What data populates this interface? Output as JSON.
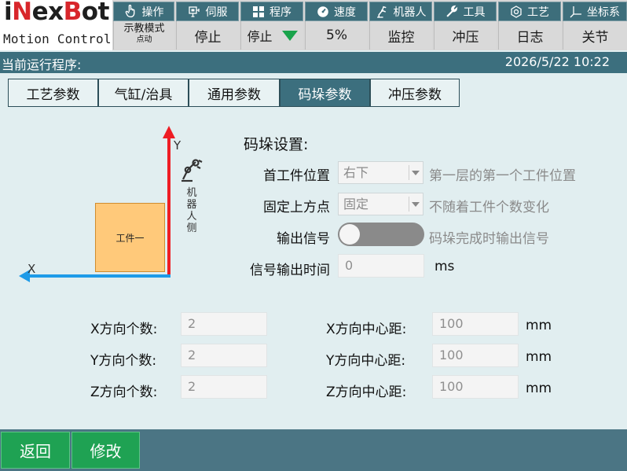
{
  "logo": {
    "brand_i": "i",
    "brand_n": "N",
    "brand_ex": "ex",
    "brand_b": "B",
    "brand_ot": "ot",
    "subtitle": "Motion Control"
  },
  "top_menu": [
    {
      "label": "操作",
      "icon": "hand-pointer-icon"
    },
    {
      "label": "伺服",
      "icon": "servo-icon"
    },
    {
      "label": "程序",
      "icon": "program-grid-icon"
    },
    {
      "label": "速度",
      "icon": "speed-gauge-icon"
    },
    {
      "label": "机器人",
      "icon": "robot-arm-icon"
    },
    {
      "label": "工具",
      "icon": "wrench-icon"
    },
    {
      "label": "工艺",
      "icon": "process-icon"
    },
    {
      "label": "坐标系",
      "icon": "coordinate-axes-icon"
    }
  ],
  "status_row": {
    "mode_line1": "示教模式",
    "mode_line2": "点动",
    "stop1": "停止",
    "stop2": "停止",
    "speed": "5%",
    "monitor": "监控",
    "press": "冲压",
    "log": "日志",
    "joint": "关节"
  },
  "statusbar": {
    "program_label": "当前运行程序:",
    "datetime": "2026/5/22 10:22"
  },
  "tabs": [
    {
      "label": "工艺参数",
      "active": false
    },
    {
      "label": "气缸/治具",
      "active": false
    },
    {
      "label": "通用参数",
      "active": false
    },
    {
      "label": "码垛参数",
      "active": true
    },
    {
      "label": "冲压参数",
      "active": false
    }
  ],
  "diagram": {
    "axis_y": "Y",
    "axis_x": "X",
    "workpiece": "工件一",
    "robot_side": [
      "机",
      "器",
      "人",
      "侧"
    ],
    "colors": {
      "y_axis": "#ee1d24",
      "x_axis": "#1e9be8",
      "workpiece": "#ffc97a"
    }
  },
  "settings": {
    "title": "码垛设置:",
    "first_position": {
      "label": "首工件位置",
      "value": "右下",
      "hint": "第一层的第一个工件位置"
    },
    "fixed_top": {
      "label": "固定上方点",
      "value": "固定",
      "hint": "不随着工件个数变化"
    },
    "output_signal": {
      "label": "输出信号",
      "on": false,
      "hint": "码垛完成时输出信号"
    },
    "signal_time": {
      "label": "信号输出时间",
      "value": "0",
      "unit": "ms"
    }
  },
  "counts": {
    "x_count": {
      "label": "X方向个数:",
      "value": "2"
    },
    "y_count": {
      "label": "Y方向个数:",
      "value": "2"
    },
    "z_count": {
      "label": "Z方向个数:",
      "value": "2"
    },
    "x_pitch": {
      "label": "X方向中心距:",
      "value": "100",
      "unit": "mm"
    },
    "y_pitch": {
      "label": "Y方向中心距:",
      "value": "100",
      "unit": "mm"
    },
    "z_pitch": {
      "label": "Z方向中心距:",
      "value": "100",
      "unit": "mm"
    }
  },
  "bottom": {
    "back": "返回",
    "modify": "修改"
  },
  "colors": {
    "accent": "#3c6f7e",
    "button_green": "#1fa253",
    "background": "#e1eef0"
  }
}
